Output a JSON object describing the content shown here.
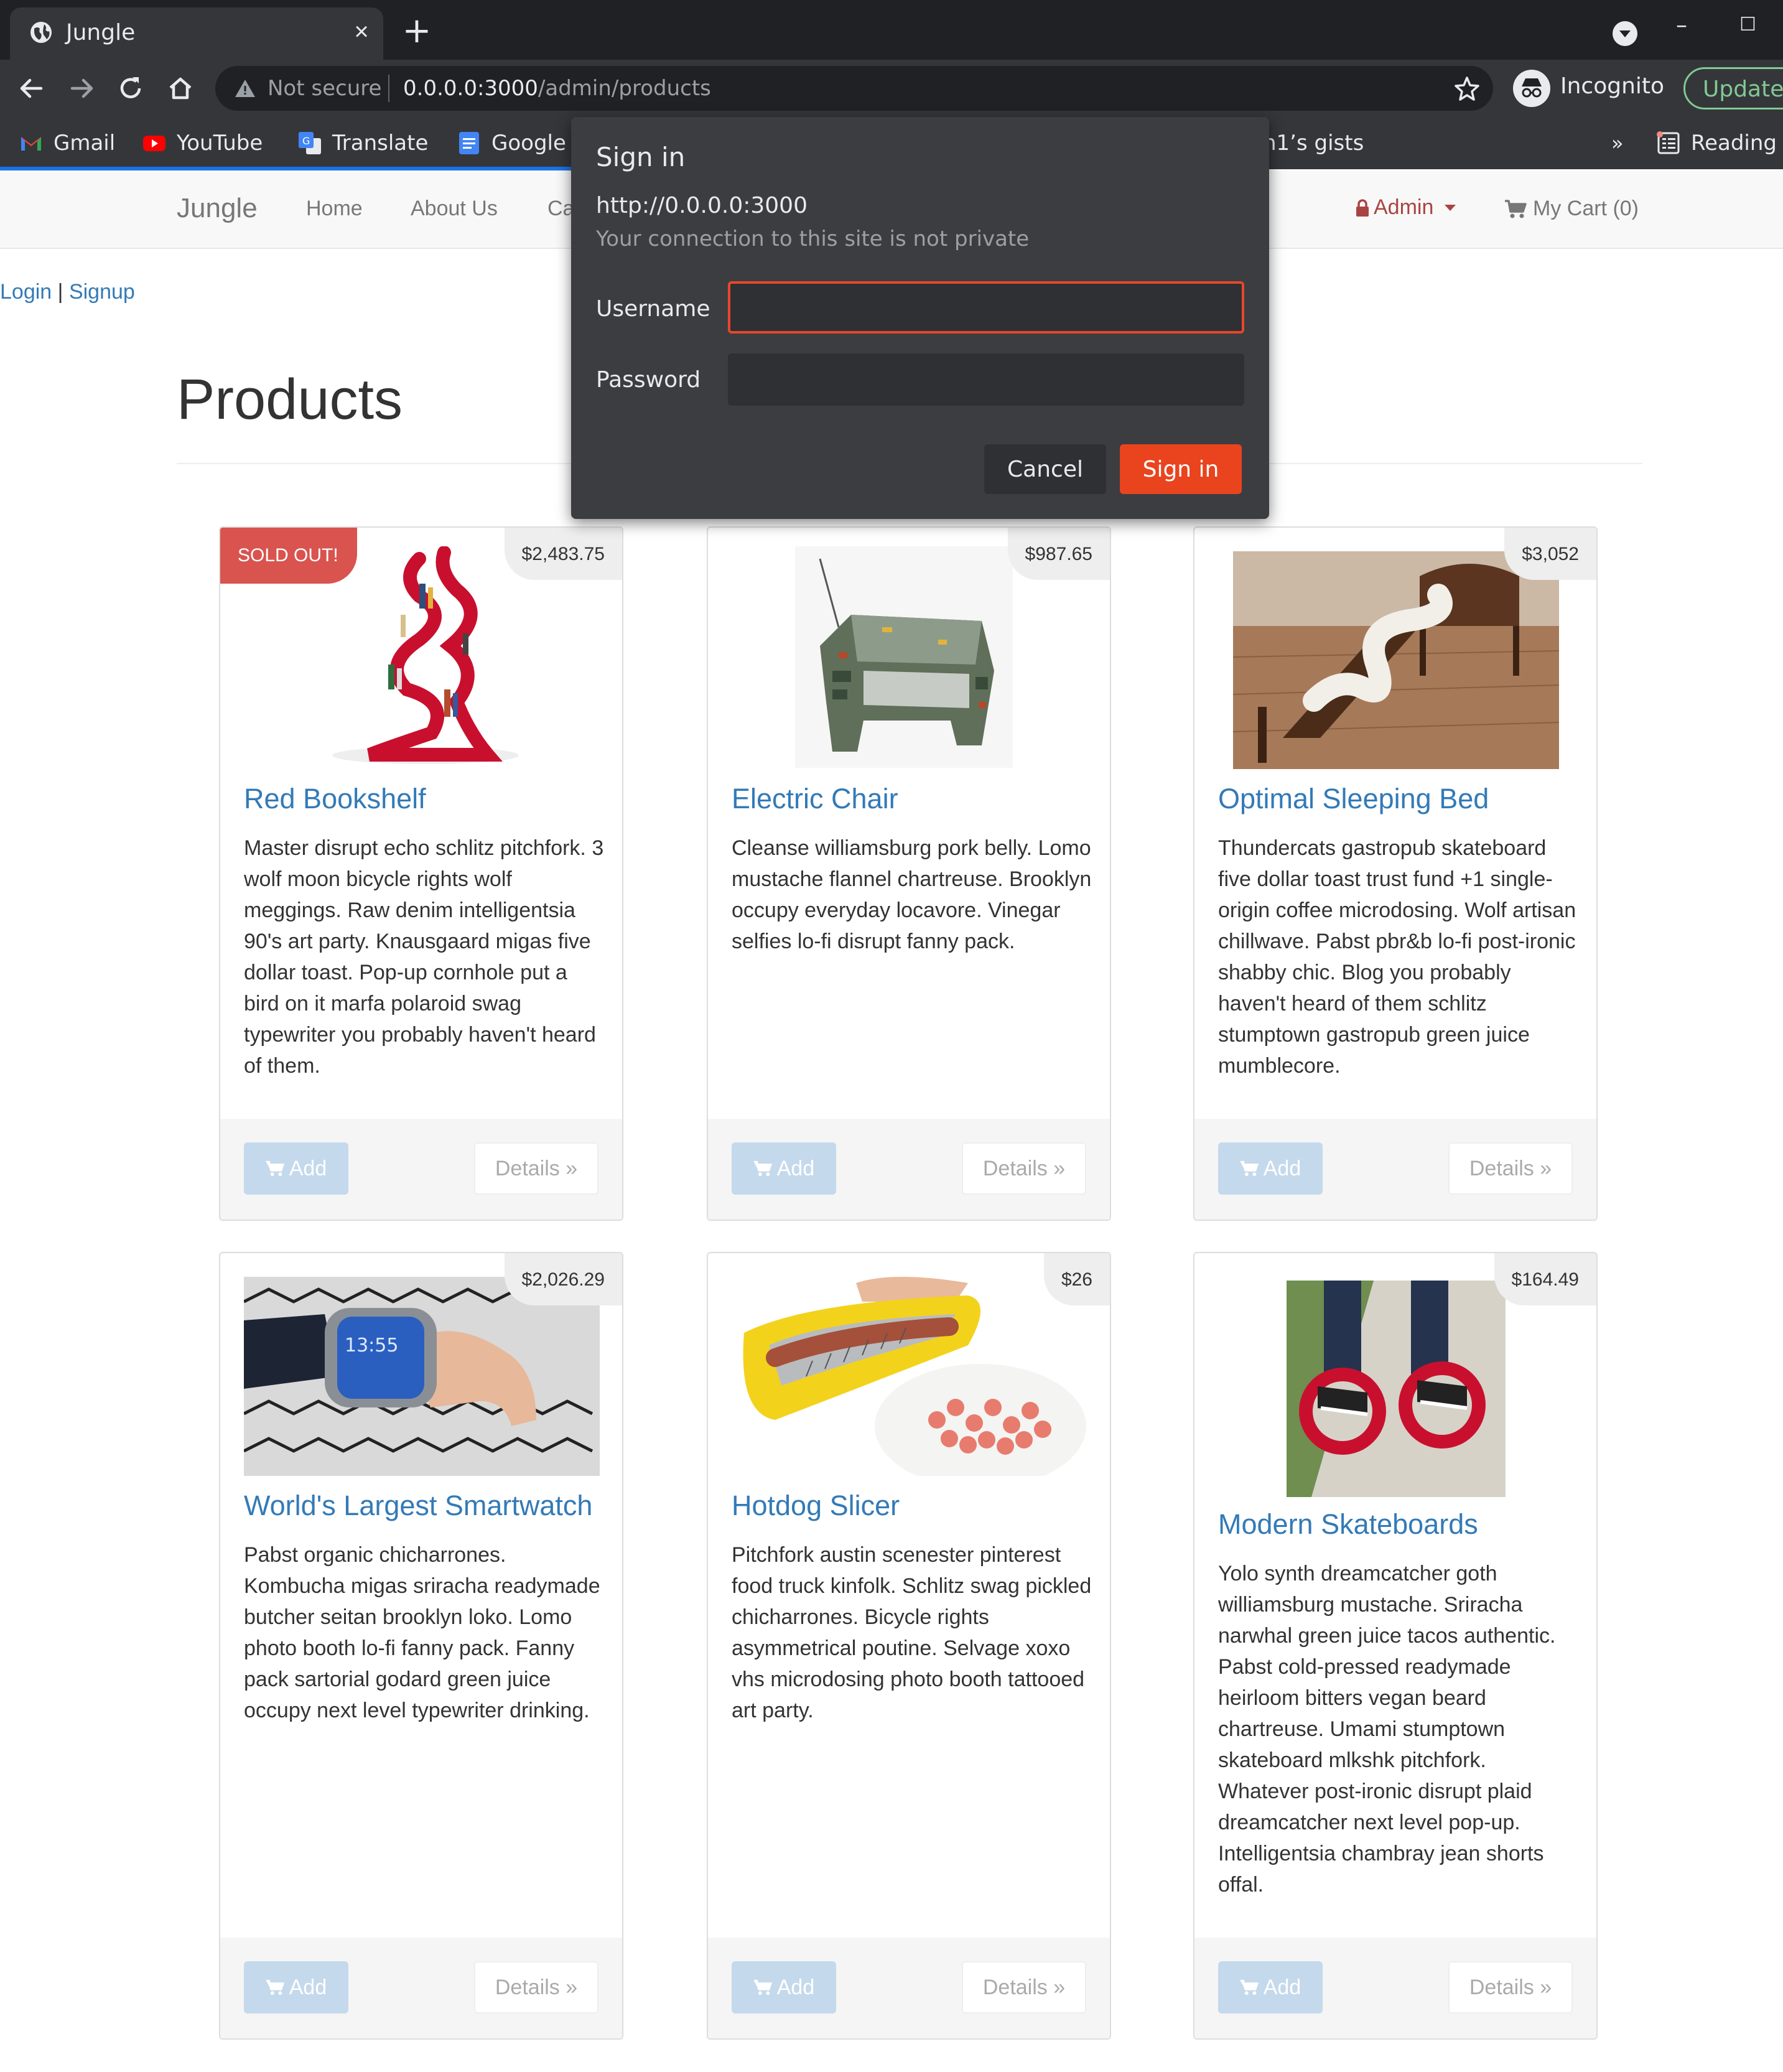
{
  "browser": {
    "tab_title": "Jungle",
    "tab_close": "×",
    "new_tab": "+",
    "window_minimize": "–",
    "window_maximize": "☐",
    "omnibox": {
      "security_label": "Not secure",
      "url_host": "0.0.0.0:3000",
      "url_path": "/admin/products"
    },
    "incognito_label": "Incognito",
    "update_label": "Update",
    "bookmarks": [
      {
        "label": "Gmail",
        "icon": "gmail-icon"
      },
      {
        "label": "YouTube",
        "icon": "youtube-icon"
      },
      {
        "label": "Translate",
        "icon": "translate-icon"
      },
      {
        "label": "Google",
        "icon": "google-docs-icon"
      },
      {
        "label": "n1’s gists",
        "icon": "none"
      }
    ],
    "bookmarks_overflow": "»",
    "reading_list_label": "Reading"
  },
  "site": {
    "brand": "Jungle",
    "nav": {
      "home": "Home",
      "about": "About Us",
      "categories": "Ca"
    },
    "admin_label": "Admin",
    "cart_label": "My Cart (0)",
    "auth": {
      "login": "Login",
      "separator": " | ",
      "signup": "Signup"
    },
    "page_title": "Products",
    "add_label": "Add",
    "details_label": "Details »"
  },
  "products": [
    {
      "name": "Red Bookshelf",
      "price": "$2,483.75",
      "sold_out": "SOLD OUT!",
      "description": "Master disrupt echo schlitz pitchfork. 3 wolf moon bicycle rights wolf meggings. Raw denim intelligentsia 90's art party. Knausgaard migas five dollar toast. Pop-up cornhole put a bird on it marfa polaroid swag typewriter you probably haven't heard of them."
    },
    {
      "name": "Electric Chair",
      "price": "$987.65",
      "description": "Cleanse williamsburg pork belly. Lomo mustache flannel chartreuse. Brooklyn occupy everyday locavore. Vinegar selfies lo-fi disrupt fanny pack."
    },
    {
      "name": "Optimal Sleeping Bed",
      "price": "$3,052",
      "description": "Thundercats gastropub skateboard five dollar toast trust fund +1 single-origin coffee microdosing. Wolf artisan chillwave. Pabst pbr&b lo-fi post-ironic shabby chic. Blog you probably haven't heard of them schlitz stumptown gastropub green juice mumblecore."
    },
    {
      "name": "World's Largest Smartwatch",
      "price": "$2,026.29",
      "watch_time": "13:55",
      "description": "Pabst organic chicharrones. Kombucha migas sriracha readymade butcher seitan brooklyn loko. Lomo photo booth lo-fi fanny pack. Fanny pack sartorial godard green juice occupy next level typewriter drinking."
    },
    {
      "name": "Hotdog Slicer",
      "price": "$26",
      "description": "Pitchfork austin scenester pinterest food truck kinfolk. Schlitz swag pickled chicharrones. Bicycle rights asymmetrical poutine. Selvage xoxo vhs microdosing photo booth tattooed art party."
    },
    {
      "name": "Modern Skateboards",
      "price": "$164.49",
      "description": "Yolo synth dreamcatcher goth williamsburg mustache. Sriracha narwhal green juice tacos authentic. Pabst cold-pressed readymade heirloom bitters vegan beard chartreuse. Umami stumptown skateboard mlkshk pitchfork. Whatever post-ironic disrupt plaid dreamcatcher next level pop-up. Intelligentsia chambray jean shorts offal."
    }
  ],
  "dialog": {
    "title": "Sign in",
    "origin": "http://0.0.0.0:3000",
    "warning": "Your connection to this site is not private",
    "username_label": "Username",
    "password_label": "Password",
    "username_value": "",
    "password_value": "",
    "cancel_label": "Cancel",
    "signin_label": "Sign in"
  },
  "colors": {
    "link": "#337ab7",
    "sold_out": "#d9534f",
    "signin_button": "#e9441e",
    "admin": "#a94442"
  }
}
